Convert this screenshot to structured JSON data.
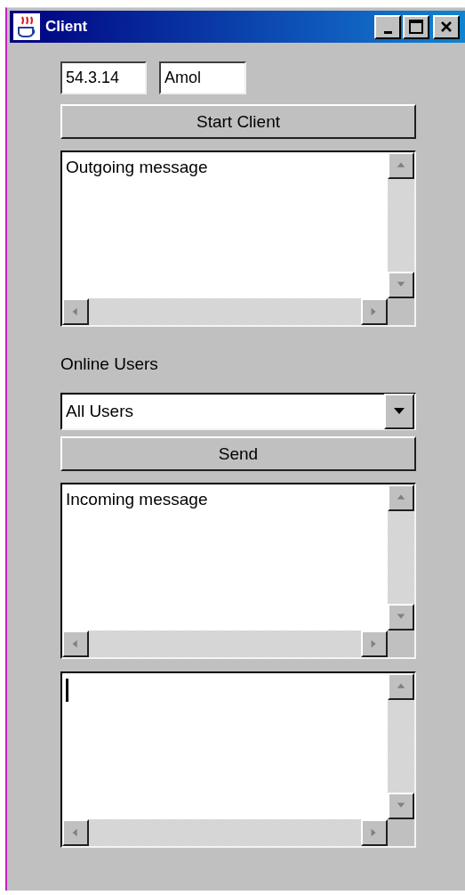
{
  "window": {
    "title": "Client"
  },
  "fields": [
    {
      "value": "54.3.14"
    },
    {
      "value": "Amol"
    }
  ],
  "start_button": "Start Client",
  "outgoing": {
    "text": "Outgoing message"
  },
  "online_users_label": "Online Users",
  "users_dropdown": {
    "value": "All Users"
  },
  "send_button": "Send",
  "incoming": {
    "text": "Incoming message"
  },
  "compose": {
    "focused": true
  }
}
